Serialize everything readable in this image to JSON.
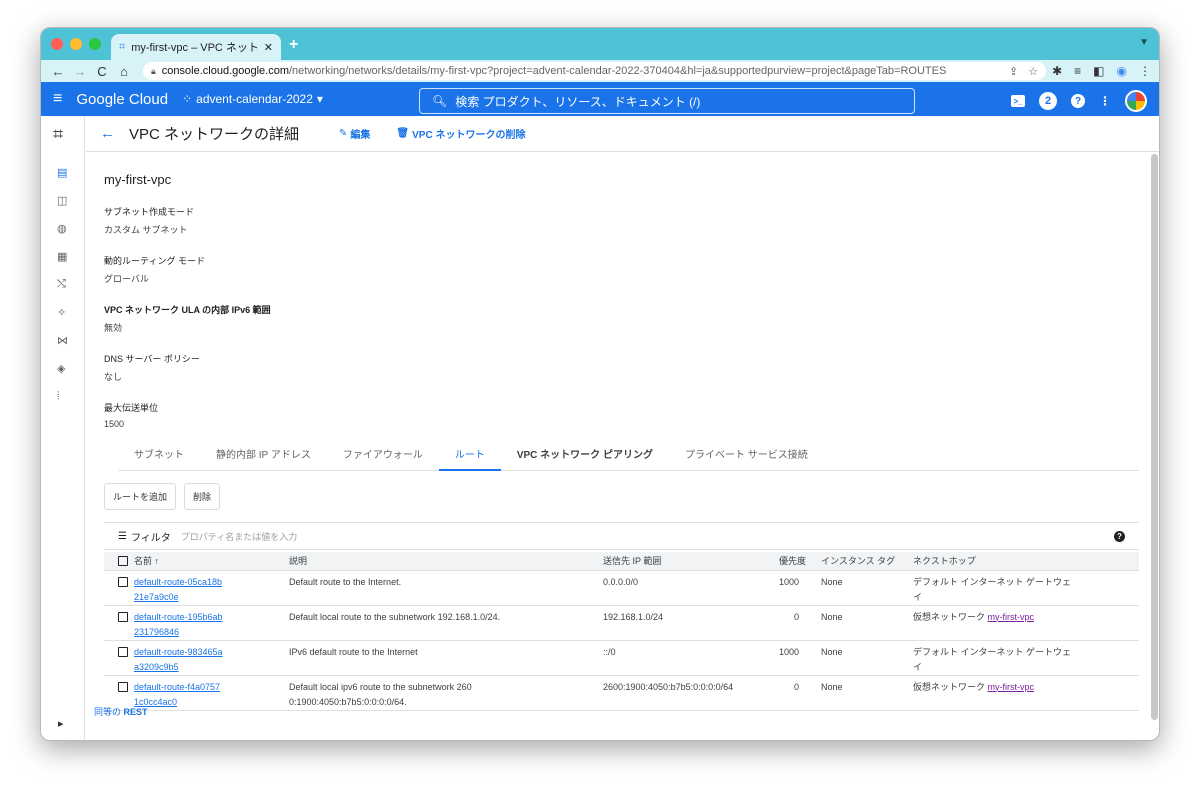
{
  "browser": {
    "tab_title": "my-first-vpc – VPC ネットワー",
    "url_host": "console.cloud.google.com",
    "url_path": "/networking/networks/details/my-first-vpc?project=advent-calendar-2022-370404&hl=ja&supportedpurview=project&pageTab=ROUTES"
  },
  "header": {
    "logo": "Google Cloud",
    "project": "advent-calendar-2022",
    "search_placeholder": "検索  プロダクト、リソース、ドキュメント (/)",
    "notifications_count": "2"
  },
  "page": {
    "title": "VPC ネットワークの詳細",
    "edit_label": "編集",
    "delete_label": "VPC ネットワークの削除",
    "vpc_name": "my-first-vpc"
  },
  "properties": [
    {
      "label": "サブネット作成モード",
      "value": "カスタム サブネット"
    },
    {
      "label": "動的ルーティング モード",
      "value": "グローバル"
    },
    {
      "label": "VPC ネットワーク ULA の内部 IPv6 範囲",
      "value": "無効"
    },
    {
      "label": "DNS サーバー ポリシー",
      "value": "なし"
    },
    {
      "label": "最大伝送単位",
      "value": "1500"
    }
  ],
  "tabs": [
    "サブネット",
    "静的内部 IP アドレス",
    "ファイアウォール",
    "ルート",
    "VPC ネットワーク ピアリング",
    "プライベート サービス接続"
  ],
  "buttons": {
    "add_route": "ルートを追加",
    "delete": "削除"
  },
  "filter": {
    "label": "フィルタ",
    "placeholder": "プロパティ名または値を入力"
  },
  "table": {
    "headers": [
      "名前",
      "説明",
      "送信先 IP 範囲",
      "優先度",
      "インスタンス タグ",
      "ネクストホップ"
    ],
    "rows": [
      {
        "name": "default-route-05ca18b21e7a9c0e",
        "desc": "Default route to the Internet.",
        "dest": "0.0.0.0/0",
        "priority": "1000",
        "tags": "None",
        "hop": "デフォルト インターネット ゲートウェイ",
        "hop_link": ""
      },
      {
        "name": "default-route-195b6ab231796846",
        "desc": "Default local route to the subnetwork 192.168.1.0/24.",
        "dest": "192.168.1.0/24",
        "priority": "0",
        "tags": "None",
        "hop": "仮想ネットワーク ",
        "hop_link": "my-first-vpc"
      },
      {
        "name": "default-route-983465aa3209c9b5",
        "desc": "IPv6 default route to the Internet",
        "dest": "::/0",
        "priority": "1000",
        "tags": "None",
        "hop": "デフォルト インターネット ゲートウェイ",
        "hop_link": ""
      },
      {
        "name": "default-route-f4a07571c0cc4ac0",
        "desc": "Default local ipv6 route to the subnetwork 2600:1900:4050:b7b5:0:0:0:0/64.",
        "dest": "2600:1900:4050:b7b5:0:0:0:0/64",
        "priority": "0",
        "tags": "None",
        "hop": "仮想ネットワーク ",
        "hop_link": "my-first-vpc"
      }
    ]
  },
  "rest_prefix": "同等の",
  "rest_label": "REST"
}
